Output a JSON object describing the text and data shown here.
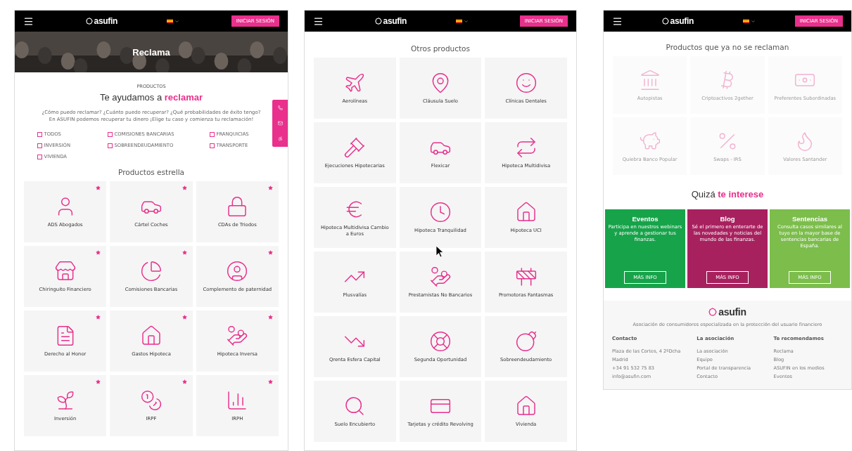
{
  "reclama_page": {
    "header": {
      "logo": "asufin",
      "login_button": "INICIAR SESIÓN"
    },
    "hero": {
      "title": "Reclama"
    },
    "eyebrow": "PRODUCTOS",
    "heading": "Te ayudamos a **reclamar**",
    "intro": [
      "¿Cómo puedo reclamar? ¿Cuánto puedo recuperar? ¿Qué probabilidades de éxito tengo?",
      "En ASUFIN podemos recuperar tu dinero ¡Elige tu caso y comienza tu reclamación!"
    ],
    "filters": [
      {
        "label": "TODOS",
        "checked": false
      },
      {
        "label": "COMISIONES BANCARIAS",
        "checked": false
      },
      {
        "label": "FRANQUICIAS",
        "checked": false
      },
      {
        "label": "INVERSIÓN",
        "checked": false
      },
      {
        "label": "SOBREENDEUDAMIENTO",
        "checked": false
      },
      {
        "label": "TRANSPORTE",
        "checked": false
      },
      {
        "label": "VIVIENDA",
        "checked": false
      }
    ],
    "featured": {
      "title": "Productos estrella",
      "items": [
        {
          "name": "ADS Abogados",
          "starred": true
        },
        {
          "name": "Cártel Coches",
          "starred": true
        },
        {
          "name": "CDAs de Triodos",
          "starred": true
        },
        {
          "name": "Chiringuito Financiero",
          "starred": true
        },
        {
          "name": "Comisiones Bancarias",
          "starred": true
        },
        {
          "name": "Complemento de paternidad",
          "starred": true
        },
        {
          "name": "Derecho al Honor",
          "starred": true
        },
        {
          "name": "Gastos Hipoteca",
          "starred": true
        },
        {
          "name": "Hipoteca Inversa",
          "starred": true
        },
        {
          "name": "Inversión",
          "starred": true
        },
        {
          "name": "IRPF",
          "starred": true
        },
        {
          "name": "IRPH",
          "starred": true
        }
      ]
    }
  },
  "otros_page": {
    "header": {
      "logo": "asufin",
      "login_button": "INICIAR SESIÓN"
    },
    "title": "Otros productos",
    "items": [
      {
        "name": "Aerolíneas"
      },
      {
        "name": "Cláusula Suelo"
      },
      {
        "name": "Clínicas Dentales"
      },
      {
        "name": "Ejecuciones Hipotecarias"
      },
      {
        "name": "Flexicar"
      },
      {
        "name": "Hipoteca Multidivisa"
      },
      {
        "name": "Hipoteca Multidivisa Cambio a Euros"
      },
      {
        "name": "Hipoteca Tranquilidad"
      },
      {
        "name": "Hipoteca UCI"
      },
      {
        "name": "Plusvalías"
      },
      {
        "name": "Prestamistas No Bancarios"
      },
      {
        "name": "Promotoras Fantasmas"
      },
      {
        "name": "Qrenta Esfera Capital"
      },
      {
        "name": "Segunda Oportunidad"
      },
      {
        "name": "Sobreendeudamiento"
      },
      {
        "name": "Suelo Encubierto"
      },
      {
        "name": "Tarjetas y crédito Revolving"
      },
      {
        "name": "Vivienda"
      }
    ]
  },
  "antiguos_page": {
    "header": {
      "logo": "asufin",
      "login_button": "INICIAR SESIÓN"
    },
    "title": "Productos que ya no se reclaman",
    "items": [
      {
        "name": "Autopistas",
        "disabled": true
      },
      {
        "name": "Criptoactivos 2gether",
        "disabled": true
      },
      {
        "name": "Preferentes Subordinadas",
        "disabled": true
      },
      {
        "name": "Quiebra Banco Popular",
        "disabled": true
      },
      {
        "name": "Swaps - IRS",
        "disabled": true
      },
      {
        "name": "Valores Santander",
        "disabled": true
      }
    ],
    "interest": {
      "heading": "Quizá **te interese**",
      "cards": [
        {
          "title": "Eventos",
          "text": "Participa en nuestros webinars y aprende a gestionar tus finanzas.",
          "button": "MÁS INFO",
          "color": "#17a34a"
        },
        {
          "title": "Blog",
          "text": "Sé el primero en enterarte de las novedades y noticias del mundo de las finanzas.",
          "button": "MÁS INFO",
          "color": "#a8215f"
        },
        {
          "title": "Sentencias",
          "text": "Consulta casos similares al tuyo en la mayor base de sentencias bancarias de España.",
          "button": "MÁS INFO",
          "color": "#7cbd4c"
        }
      ]
    },
    "footer": {
      "logo": "asufin",
      "tagline": "Asociación de consumidores especializada en la protección del usuario financiero",
      "columns": [
        {
          "title": "Contacto",
          "items": [
            "Plaza de las Cortes, 4 2ºDcha",
            "Madrid",
            "+34 91 532 75 83",
            "info@asufin.com"
          ]
        },
        {
          "title": "La asociación",
          "items": [
            "La asociación",
            "Equipo",
            "Portal de transparencia",
            "Contacto"
          ]
        },
        {
          "title": "Te recomendamos",
          "items": [
            "Reclama",
            "Blog",
            "ASUFIN en los medios",
            "Eventos"
          ]
        }
      ]
    }
  }
}
